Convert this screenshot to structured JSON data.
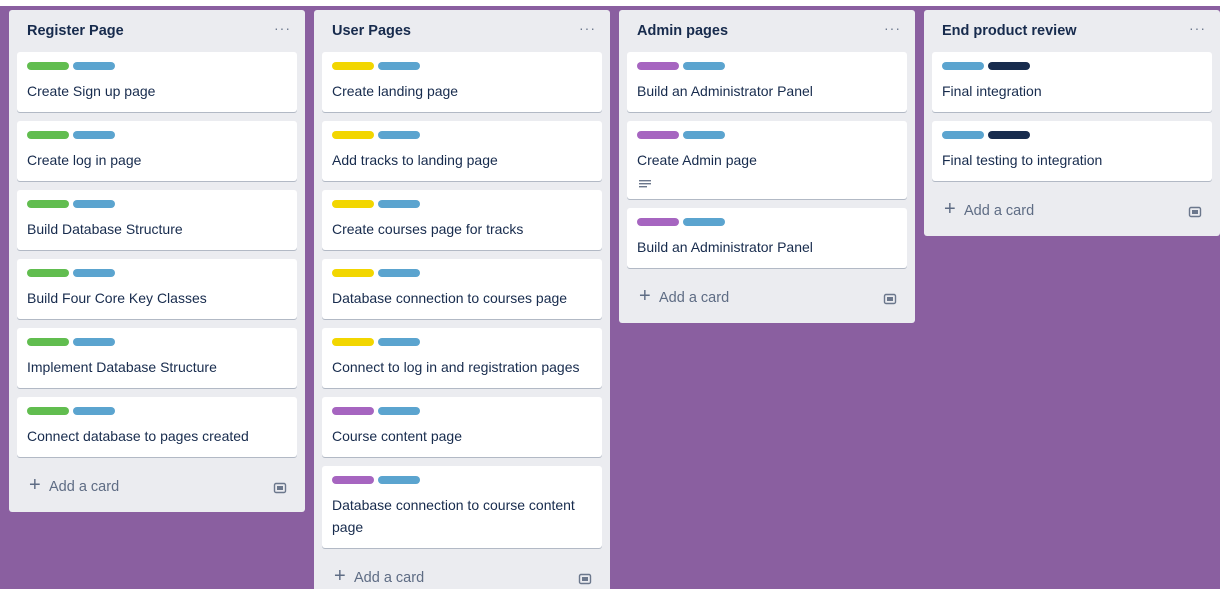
{
  "colors": {
    "board_background": "#8a5fa0",
    "green": "#61bd4f",
    "sky": "#5ba4cf",
    "yellow": "#f2d600",
    "purple": "#a665c0",
    "navy": "#172b4d"
  },
  "lists": [
    {
      "title": "Register Page",
      "menu": "···",
      "add_label": "Add a card",
      "cards": [
        {
          "title": "Create Sign up page",
          "labels": [
            "green",
            "sky"
          ]
        },
        {
          "title": "Create log in page",
          "labels": [
            "green",
            "sky"
          ]
        },
        {
          "title": "Build Database Structure",
          "labels": [
            "green",
            "sky"
          ]
        },
        {
          "title": "Build Four Core Key Classes",
          "labels": [
            "green",
            "sky"
          ]
        },
        {
          "title": "Implement Database Structure",
          "labels": [
            "green",
            "sky"
          ]
        },
        {
          "title": "Connect database to pages created",
          "labels": [
            "green",
            "sky"
          ]
        }
      ]
    },
    {
      "title": "User Pages",
      "menu": "···",
      "add_label": "Add a card",
      "cards": [
        {
          "title": "Create landing page",
          "labels": [
            "yellow",
            "sky"
          ]
        },
        {
          "title": "Add tracks to landing page",
          "labels": [
            "yellow",
            "sky"
          ]
        },
        {
          "title": "Create courses page for tracks",
          "labels": [
            "yellow",
            "sky"
          ]
        },
        {
          "title": "Database connection to courses page",
          "labels": [
            "yellow",
            "sky"
          ]
        },
        {
          "title": "Connect to log in and registration pages",
          "labels": [
            "yellow",
            "sky"
          ]
        },
        {
          "title": "Course content page",
          "labels": [
            "purple",
            "sky"
          ]
        },
        {
          "title": "Database connection to course content page",
          "labels": [
            "purple",
            "sky"
          ]
        }
      ]
    },
    {
      "title": "Admin pages",
      "menu": "···",
      "add_label": "Add a card",
      "cards": [
        {
          "title": "Build an Administrator Panel",
          "labels": [
            "purple",
            "sky"
          ]
        },
        {
          "title": "Create Admin page",
          "labels": [
            "purple",
            "sky"
          ],
          "has_description": true
        },
        {
          "title": "Build an Administrator Panel",
          "labels": [
            "purple",
            "sky"
          ]
        }
      ]
    },
    {
      "title": "End product review",
      "menu": "···",
      "add_label": "Add a card",
      "cards": [
        {
          "title": "Final integration",
          "labels": [
            "sky",
            "navy"
          ]
        },
        {
          "title": "Final testing to integration",
          "labels": [
            "sky",
            "navy"
          ]
        }
      ]
    }
  ]
}
